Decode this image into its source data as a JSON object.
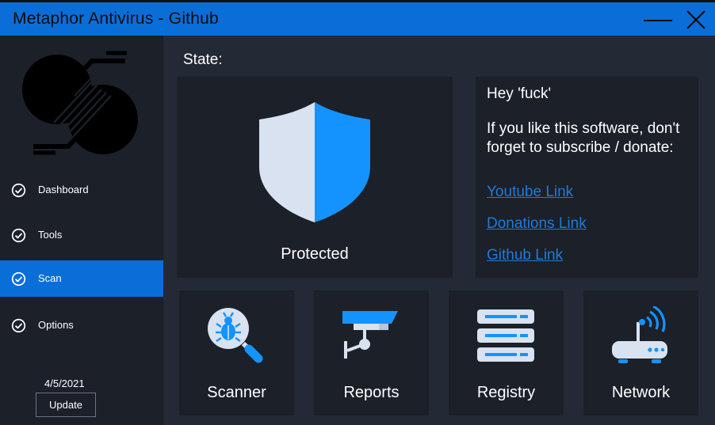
{
  "window": {
    "title": "Metaphor Antivirus - Github"
  },
  "colors": {
    "accent": "#0a6ed8",
    "panel": "#1b2029",
    "background": "#232a35",
    "link": "#1f7bd8"
  },
  "sidebar": {
    "items": [
      {
        "label": "Dashboard",
        "icon": "check-circle-icon",
        "active": false
      },
      {
        "label": "Tools",
        "icon": "check-circle-icon",
        "active": false
      },
      {
        "label": "Scan",
        "icon": "check-circle-icon",
        "active": true
      },
      {
        "label": "Options",
        "icon": "check-circle-icon",
        "active": false
      }
    ],
    "date": "4/5/2021",
    "update_label": "Update"
  },
  "main": {
    "state_label": "State:",
    "status": "Protected",
    "info": {
      "greeting": "Hey 'fuck'",
      "message": "If you like this software, don't forget to subscribe / donate:",
      "links": [
        "Youtube Link",
        "Donations Link",
        "Github Link"
      ]
    },
    "tiles": [
      {
        "label": "Scanner",
        "icon": "bug-search-icon"
      },
      {
        "label": "Reports",
        "icon": "security-camera-icon"
      },
      {
        "label": "Registry",
        "icon": "server-stack-icon"
      },
      {
        "label": "Network",
        "icon": "wifi-router-icon"
      }
    ]
  }
}
